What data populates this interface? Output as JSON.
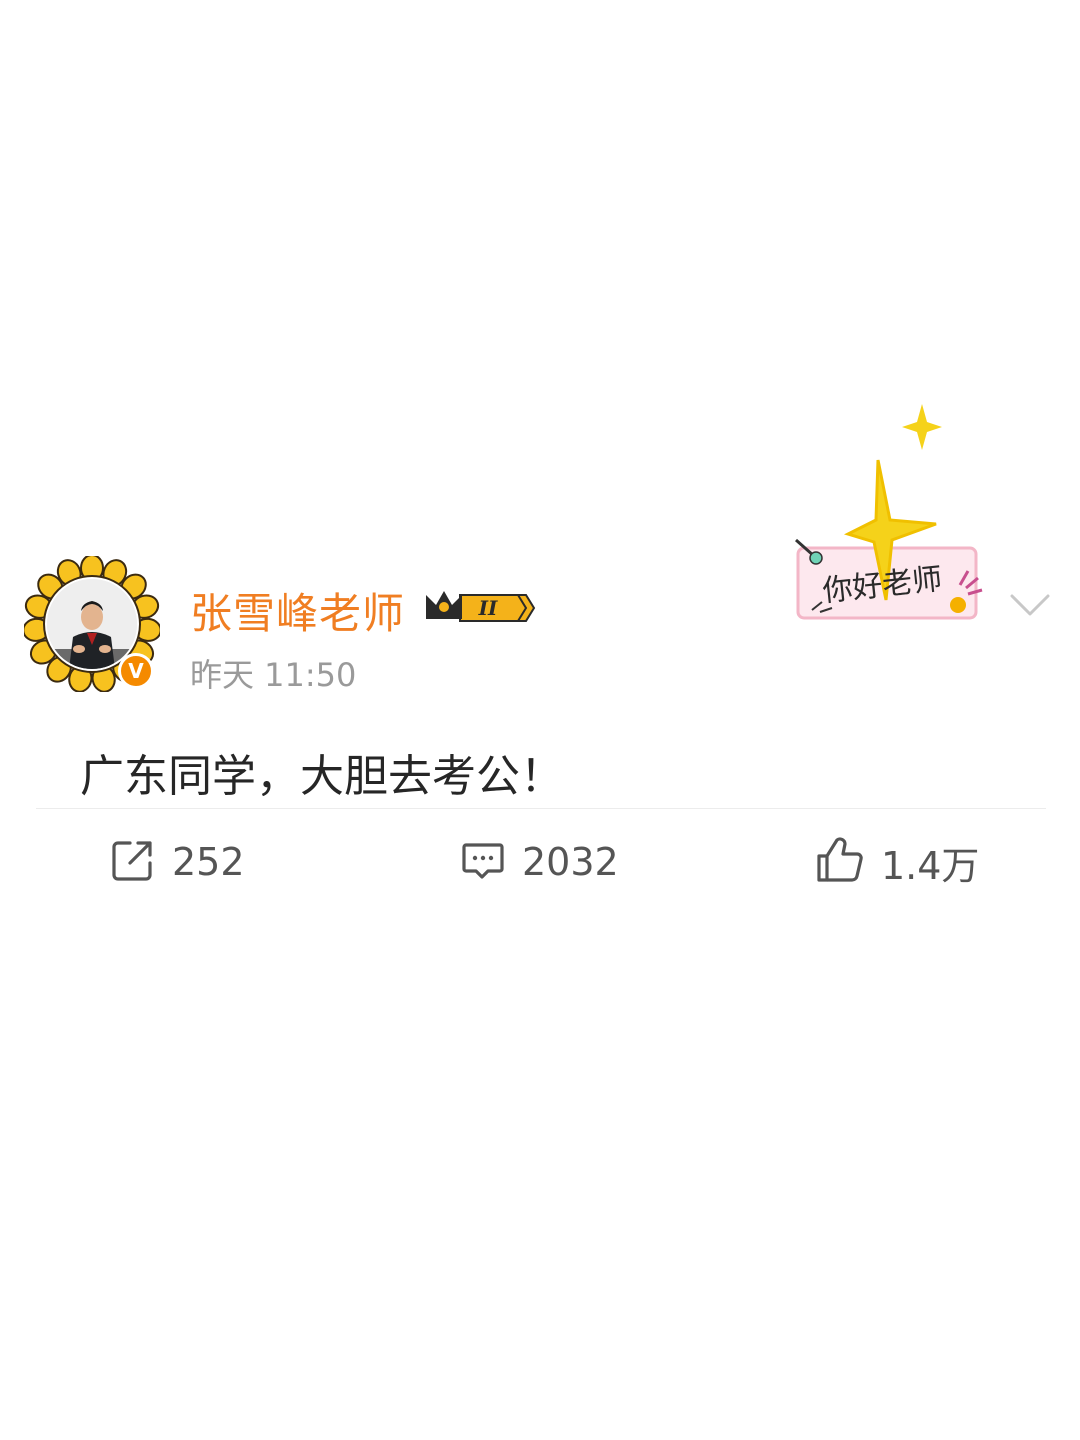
{
  "post": {
    "author": {
      "name": "张雪峰老师",
      "level_badge": "II",
      "verified_badge": "V"
    },
    "time": "昨天 11:50",
    "text": "广东同学，大胆去考公！",
    "sticker_text": "你好老师",
    "stats": {
      "reposts": "252",
      "comments": "2032",
      "likes": "1.4万"
    }
  },
  "colors": {
    "name": "#f07e22",
    "verified": "#f58a00",
    "sunflower": "#f7c21f",
    "star": "#f5d21a"
  },
  "icons": {
    "repost": "repost-icon",
    "comment": "comment-icon",
    "like": "thumbs-up-icon",
    "menu": "chevron-down-icon"
  }
}
